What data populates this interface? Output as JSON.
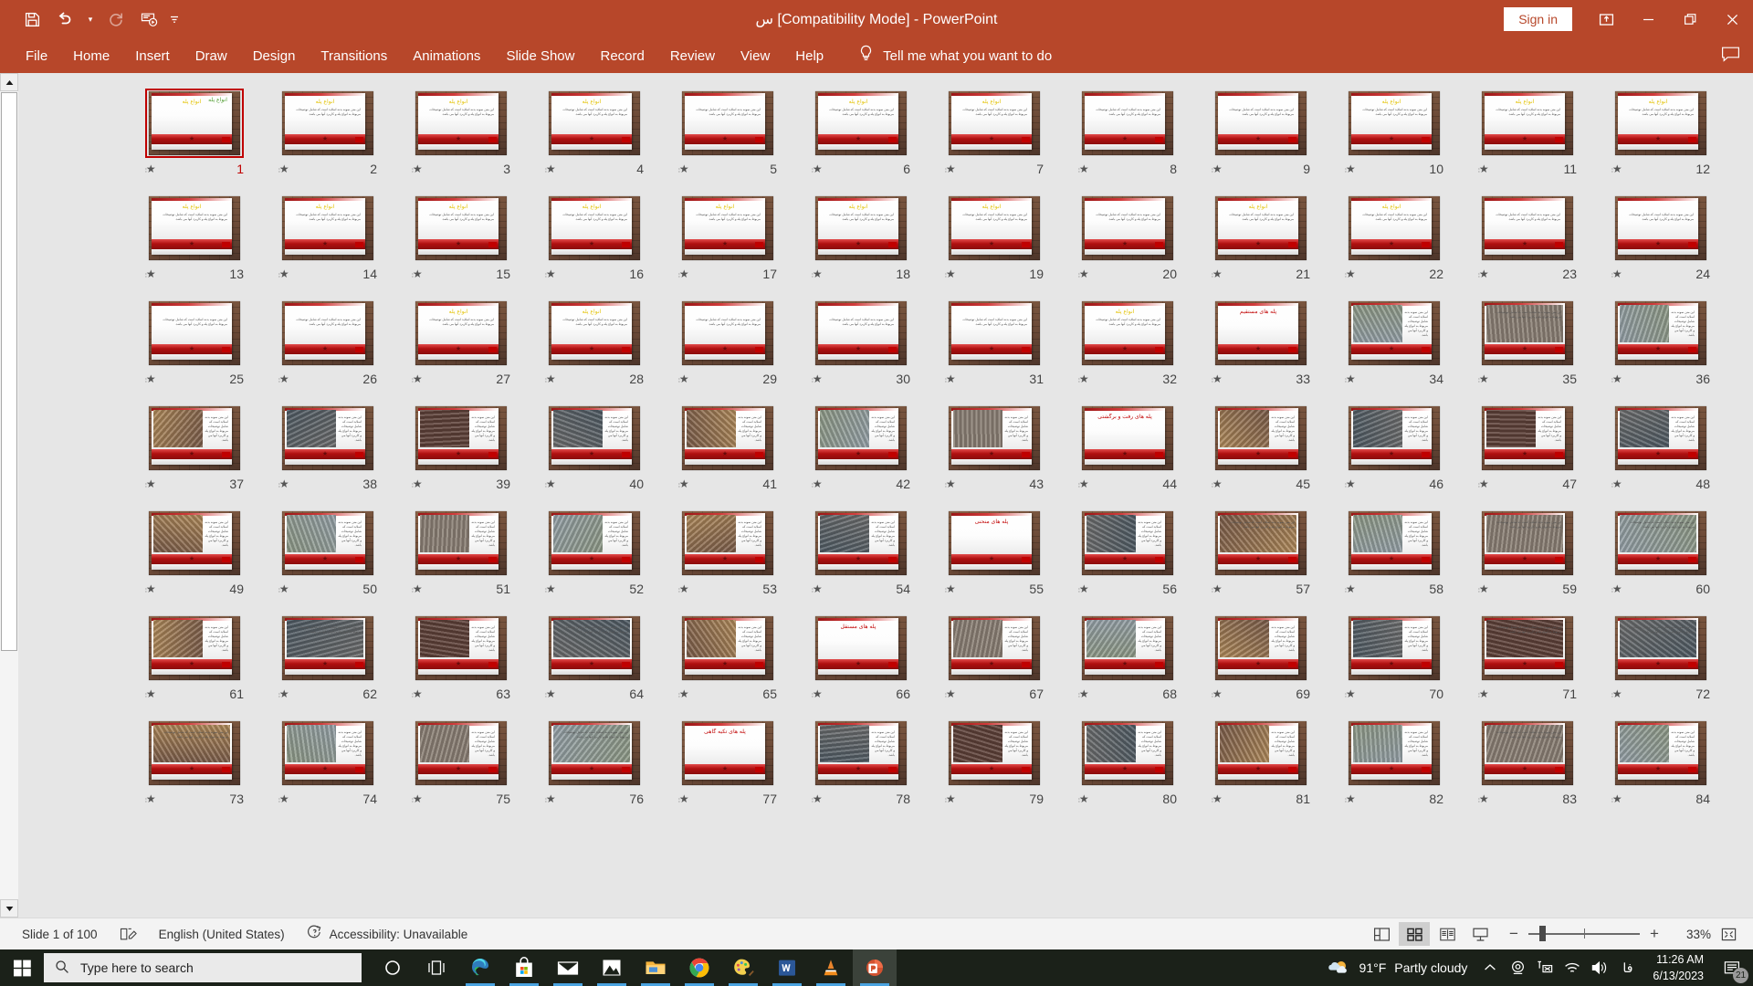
{
  "titlebar": {
    "title": "س [Compatibility Mode]  -  PowerPoint",
    "signin_label": "Sign in",
    "quick_access": [
      {
        "name": "save-icon",
        "label": "Save"
      },
      {
        "name": "undo-icon",
        "label": "Undo"
      },
      {
        "name": "undo-dropdown-icon",
        "label": "Undo options"
      },
      {
        "name": "redo-icon",
        "label": "Redo"
      },
      {
        "name": "start-presentation-icon",
        "label": "Start From Beginning"
      },
      {
        "name": "customize-quick-access-icon",
        "label": "Customize Quick Access Toolbar"
      }
    ],
    "window_controls": [
      {
        "name": "ribbon-display-options-icon",
        "label": "Ribbon Display Options"
      },
      {
        "name": "minimize-icon",
        "label": "Minimize"
      },
      {
        "name": "restore-icon",
        "label": "Restore Down"
      },
      {
        "name": "close-icon",
        "label": "Close"
      }
    ]
  },
  "ribbon": {
    "tabs": [
      {
        "label": "File"
      },
      {
        "label": "Home"
      },
      {
        "label": "Insert"
      },
      {
        "label": "Draw"
      },
      {
        "label": "Design"
      },
      {
        "label": "Transitions"
      },
      {
        "label": "Animations"
      },
      {
        "label": "Slide Show"
      },
      {
        "label": "Record"
      },
      {
        "label": "Review"
      },
      {
        "label": "View"
      },
      {
        "label": "Help"
      }
    ],
    "tellme_placeholder": "Tell me what you want to do",
    "comments_label": "Comments"
  },
  "statusbar": {
    "slide_counter": "Slide 1 of 100",
    "language": "English (United States)",
    "accessibility": "Accessibility: Unavailable",
    "zoom_percent": "33%",
    "views": [
      {
        "name": "normal-view-button",
        "label": "Normal",
        "active": false
      },
      {
        "name": "slide-sorter-view-button",
        "label": "Slide Sorter",
        "active": true
      },
      {
        "name": "reading-view-button",
        "label": "Reading View",
        "active": false
      },
      {
        "name": "slide-show-button",
        "label": "Slide Show",
        "active": false
      }
    ],
    "zoom_out_label": "−",
    "zoom_in_label": "+",
    "fit_label": "Fit slide to current window"
  },
  "taskbar": {
    "search_placeholder": "Type here to search",
    "apps": [
      {
        "name": "taskbar-cortana-icon",
        "label": "Cortana"
      },
      {
        "name": "taskbar-task-view-icon",
        "label": "Task View"
      },
      {
        "name": "taskbar-edge-icon",
        "label": "Microsoft Edge"
      },
      {
        "name": "taskbar-store-icon",
        "label": "Microsoft Store"
      },
      {
        "name": "taskbar-mail-icon",
        "label": "Mail"
      },
      {
        "name": "taskbar-photos-icon",
        "label": "Photos"
      },
      {
        "name": "taskbar-file-explorer-icon",
        "label": "File Explorer"
      },
      {
        "name": "taskbar-chrome-icon",
        "label": "Google Chrome"
      },
      {
        "name": "taskbar-paint-icon",
        "label": "Paint"
      },
      {
        "name": "taskbar-word-icon",
        "label": "Microsoft Word"
      },
      {
        "name": "taskbar-vlc-icon",
        "label": "VLC media player"
      },
      {
        "name": "taskbar-powerpoint-icon",
        "label": "Microsoft PowerPoint"
      }
    ],
    "tray": {
      "temperature": "91°F",
      "weather": "Partly cloudy",
      "ime": "فا",
      "time": "11:26 AM",
      "date": "6/13/2023",
      "notification_count": "21"
    }
  },
  "slides": {
    "total": 100,
    "selected": 1,
    "titles": {
      "33": "پله های مستقیم",
      "44": "پله های رفت و برگشتی",
      "55": "پله های منحنی",
      "66": "پله های مستقل",
      "77": "پله های تکیه گاهی"
    },
    "items": [
      {
        "n": 12,
        "kind": "text",
        "title": "انواع پله",
        "title_color": "yellow"
      },
      {
        "n": 11,
        "kind": "text",
        "title": "انواع پله",
        "title_color": "yellow"
      },
      {
        "n": 10,
        "kind": "text",
        "title": "انواع پله",
        "title_color": "yellow"
      },
      {
        "n": 9,
        "kind": "text",
        "title": "",
        "title_color": "red"
      },
      {
        "n": 8,
        "kind": "text",
        "title": "",
        "title_color": "red"
      },
      {
        "n": 7,
        "kind": "text",
        "title": "انواع پله",
        "title_color": "yellow"
      },
      {
        "n": 6,
        "kind": "text",
        "title": "انواع پله",
        "title_color": "yellow"
      },
      {
        "n": 5,
        "kind": "text",
        "title": "",
        "title_color": "red"
      },
      {
        "n": 4,
        "kind": "text",
        "title": "انواع پله",
        "title_color": "yellow"
      },
      {
        "n": 3,
        "kind": "text",
        "title": "انواع پله",
        "title_color": "yellow"
      },
      {
        "n": 2,
        "kind": "text",
        "title": "انواع پله",
        "title_color": "yellow"
      },
      {
        "n": 1,
        "kind": "title",
        "title": "انواع پله",
        "title_color": "yellow"
      },
      {
        "n": 24,
        "kind": "text",
        "title": "",
        "title_color": "red"
      },
      {
        "n": 23,
        "kind": "text",
        "title": "",
        "title_color": "red"
      },
      {
        "n": 22,
        "kind": "text",
        "title": "انواع پله",
        "title_color": "yellow"
      },
      {
        "n": 21,
        "kind": "text",
        "title": "انواع پله",
        "title_color": "yellow"
      },
      {
        "n": 20,
        "kind": "text",
        "title": "",
        "title_color": "red"
      },
      {
        "n": 19,
        "kind": "text",
        "title": "انواع پله",
        "title_color": "yellow"
      },
      {
        "n": 18,
        "kind": "text",
        "title": "انواع پله",
        "title_color": "yellow"
      },
      {
        "n": 17,
        "kind": "text",
        "title": "انواع پله",
        "title_color": "yellow"
      },
      {
        "n": 16,
        "kind": "text",
        "title": "انواع پله",
        "title_color": "yellow"
      },
      {
        "n": 15,
        "kind": "text",
        "title": "انواع پله",
        "title_color": "yellow"
      },
      {
        "n": 14,
        "kind": "text",
        "title": "انواع پله",
        "title_color": "yellow"
      },
      {
        "n": 13,
        "kind": "text",
        "title": "انواع پله",
        "title_color": "yellow"
      },
      {
        "n": 36,
        "kind": "photo",
        "title": "",
        "title_color": "red"
      },
      {
        "n": 35,
        "kind": "photo-wide",
        "title": "",
        "title_color": "red"
      },
      {
        "n": 34,
        "kind": "photo",
        "title": "",
        "title_color": "red"
      },
      {
        "n": 33,
        "kind": "heading",
        "title": "پله های مستقیم",
        "title_color": "red"
      },
      {
        "n": 32,
        "kind": "text",
        "title": "انواع پله",
        "title_color": "yellow"
      },
      {
        "n": 31,
        "kind": "text",
        "title": "",
        "title_color": "red"
      },
      {
        "n": 30,
        "kind": "text",
        "title": "",
        "title_color": "red"
      },
      {
        "n": 29,
        "kind": "text",
        "title": "",
        "title_color": "red"
      },
      {
        "n": 28,
        "kind": "text",
        "title": "انواع پله",
        "title_color": "yellow"
      },
      {
        "n": 27,
        "kind": "text",
        "title": "انواع پله",
        "title_color": "yellow"
      },
      {
        "n": 26,
        "kind": "text",
        "title": "",
        "title_color": "red"
      },
      {
        "n": 25,
        "kind": "text",
        "title": "",
        "title_color": "red"
      },
      {
        "n": 48,
        "kind": "photo",
        "title": "",
        "title_color": "red"
      },
      {
        "n": 47,
        "kind": "photo",
        "title": "",
        "title_color": "red"
      },
      {
        "n": 46,
        "kind": "photo",
        "title": "",
        "title_color": "red"
      },
      {
        "n": 45,
        "kind": "photo",
        "title": "",
        "title_color": "red"
      },
      {
        "n": 44,
        "kind": "heading",
        "title": "پله های رفت و برگشتی",
        "title_color": "red"
      },
      {
        "n": 43,
        "kind": "photo",
        "title": "",
        "title_color": "red"
      },
      {
        "n": 42,
        "kind": "photo",
        "title": "",
        "title_color": "red"
      },
      {
        "n": 41,
        "kind": "photo",
        "title": "",
        "title_color": "red"
      },
      {
        "n": 40,
        "kind": "photo",
        "title": "",
        "title_color": "red"
      },
      {
        "n": 39,
        "kind": "photo",
        "title": "",
        "title_color": "red"
      },
      {
        "n": 38,
        "kind": "photo",
        "title": "",
        "title_color": "red"
      },
      {
        "n": 37,
        "kind": "photo",
        "title": "",
        "title_color": "red"
      },
      {
        "n": 60,
        "kind": "photo-wide",
        "title": "",
        "title_color": "red"
      },
      {
        "n": 59,
        "kind": "photo-wide",
        "title": "",
        "title_color": "red"
      },
      {
        "n": 58,
        "kind": "photo",
        "title": "",
        "title_color": "red"
      },
      {
        "n": 57,
        "kind": "photo-wide",
        "title": "",
        "title_color": "red"
      },
      {
        "n": 56,
        "kind": "photo",
        "title": "",
        "title_color": "red"
      },
      {
        "n": 55,
        "kind": "heading",
        "title": "پله های منحنی",
        "title_color": "red"
      },
      {
        "n": 54,
        "kind": "photo",
        "title": "",
        "title_color": "red"
      },
      {
        "n": 53,
        "kind": "photo",
        "title": "",
        "title_color": "red"
      },
      {
        "n": 52,
        "kind": "photo",
        "title": "",
        "title_color": "red"
      },
      {
        "n": 51,
        "kind": "photo",
        "title": "",
        "title_color": "red"
      },
      {
        "n": 50,
        "kind": "photo",
        "title": "",
        "title_color": "red"
      },
      {
        "n": 49,
        "kind": "photo",
        "title": "",
        "title_color": "red"
      },
      {
        "n": 72,
        "kind": "photo-wide",
        "title": "",
        "title_color": "red"
      },
      {
        "n": 71,
        "kind": "photo-wide",
        "title": "",
        "title_color": "red"
      },
      {
        "n": 70,
        "kind": "photo",
        "title": "",
        "title_color": "red"
      },
      {
        "n": 69,
        "kind": "photo",
        "title": "",
        "title_color": "red"
      },
      {
        "n": 68,
        "kind": "photo",
        "title": "",
        "title_color": "red"
      },
      {
        "n": 67,
        "kind": "photo",
        "title": "",
        "title_color": "red"
      },
      {
        "n": 66,
        "kind": "heading",
        "title": "پله های مستقل",
        "title_color": "red"
      },
      {
        "n": 65,
        "kind": "photo",
        "title": "",
        "title_color": "red"
      },
      {
        "n": 64,
        "kind": "photo-wide",
        "title": "",
        "title_color": "red"
      },
      {
        "n": 63,
        "kind": "photo",
        "title": "",
        "title_color": "red"
      },
      {
        "n": 62,
        "kind": "photo-wide",
        "title": "",
        "title_color": "red"
      },
      {
        "n": 61,
        "kind": "photo",
        "title": "",
        "title_color": "red"
      },
      {
        "n": 84,
        "kind": "photo",
        "title": "",
        "title_color": "red"
      },
      {
        "n": 83,
        "kind": "photo-wide",
        "title": "",
        "title_color": "red"
      },
      {
        "n": 82,
        "kind": "photo",
        "title": "",
        "title_color": "red"
      },
      {
        "n": 81,
        "kind": "photo",
        "title": "",
        "title_color": "red"
      },
      {
        "n": 80,
        "kind": "photo",
        "title": "",
        "title_color": "red"
      },
      {
        "n": 79,
        "kind": "photo",
        "title": "",
        "title_color": "red"
      },
      {
        "n": 78,
        "kind": "photo",
        "title": "",
        "title_color": "red"
      },
      {
        "n": 77,
        "kind": "heading",
        "title": "پله های تکیه گاهی",
        "title_color": "red"
      },
      {
        "n": 76,
        "kind": "photo-wide",
        "title": "",
        "title_color": "red"
      },
      {
        "n": 75,
        "kind": "photo",
        "title": "",
        "title_color": "red"
      },
      {
        "n": 74,
        "kind": "photo",
        "title": "",
        "title_color": "red"
      },
      {
        "n": 73,
        "kind": "photo-wide",
        "title": "",
        "title_color": "red"
      }
    ],
    "body_text_fa": "این متن نمونه بدنه اسلاید است که شامل توضیحات مربوط به انواع پله و کاربرد آنها می باشد."
  }
}
